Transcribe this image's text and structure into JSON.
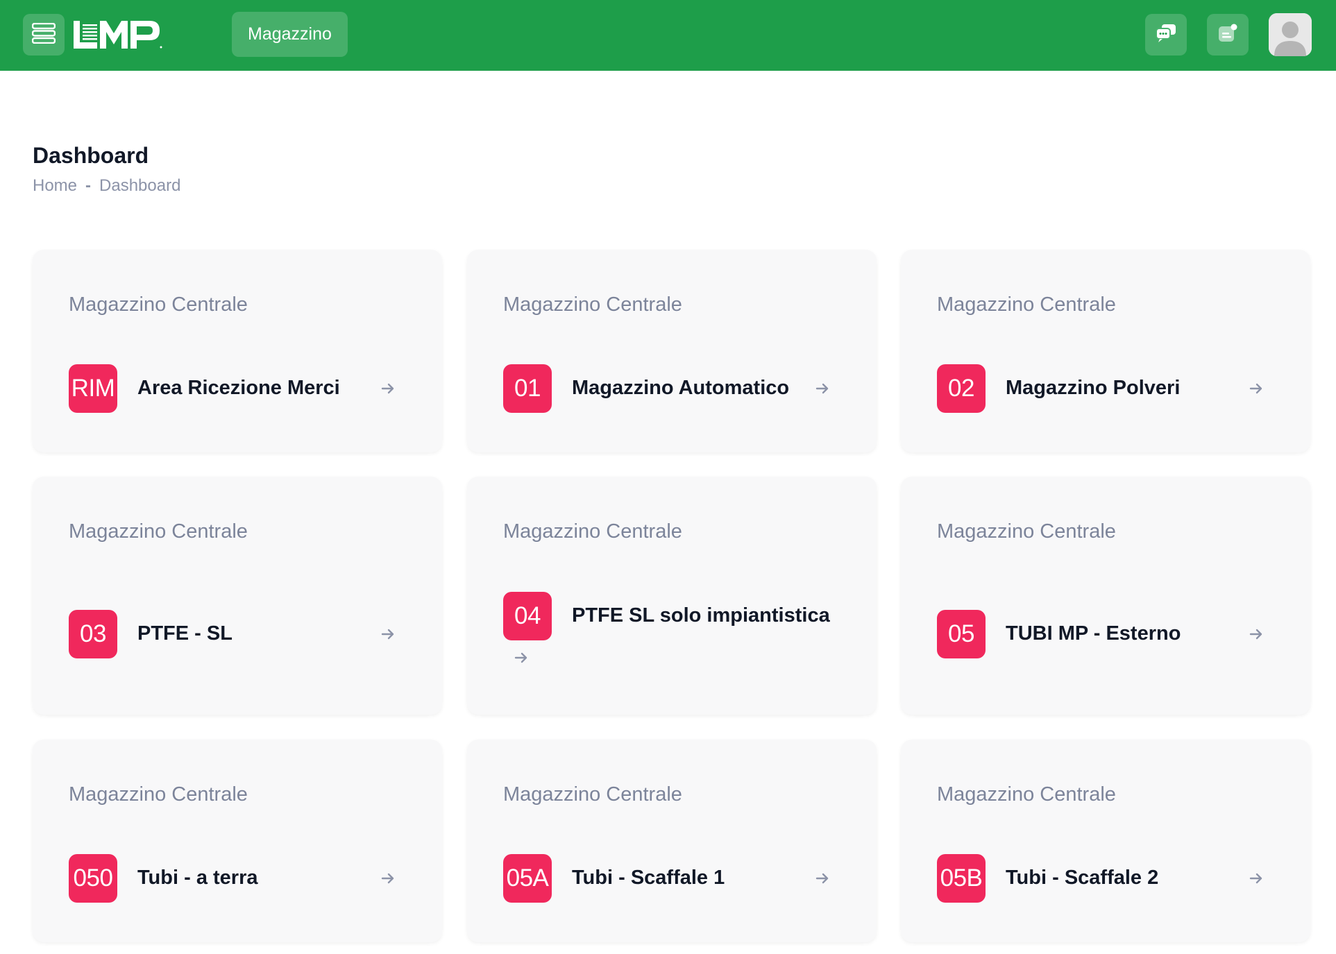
{
  "header": {
    "logo_text": "LMP",
    "nav_label": "Magazzino",
    "chat_icon": "chat-bubbles-icon",
    "notes_icon": "notes-icon",
    "avatar_icon": "user-avatar-icon",
    "background_color": "#1e9e4a"
  },
  "page": {
    "title": "Dashboard",
    "breadcrumb": [
      "Home",
      "Dashboard"
    ]
  },
  "cards": [
    {
      "subtitle": "Magazzino Centrale",
      "code": "RIM",
      "name": "Area Ricezione Merci"
    },
    {
      "subtitle": "Magazzino Centrale",
      "code": "01",
      "name": "Magazzino Automatico"
    },
    {
      "subtitle": "Magazzino Centrale",
      "code": "02",
      "name": "Magazzino Polveri"
    },
    {
      "subtitle": "Magazzino Centrale",
      "code": "03",
      "name": "PTFE - SL"
    },
    {
      "subtitle": "Magazzino Centrale",
      "code": "04",
      "name": "PTFE SL solo impiantistica"
    },
    {
      "subtitle": "Magazzino Centrale",
      "code": "05",
      "name": "TUBI MP - Esterno"
    },
    {
      "subtitle": "Magazzino Centrale",
      "code": "050",
      "name": "Tubi - a terra"
    },
    {
      "subtitle": "Magazzino Centrale",
      "code": "05A",
      "name": "Tubi - Scaffale 1"
    },
    {
      "subtitle": "Magazzino Centrale",
      "code": "05B",
      "name": "Tubi - Scaffale 2"
    }
  ],
  "colors": {
    "badge": "#f0285c",
    "card_bg": "#f8f8f9",
    "muted_text": "#7c849a"
  }
}
